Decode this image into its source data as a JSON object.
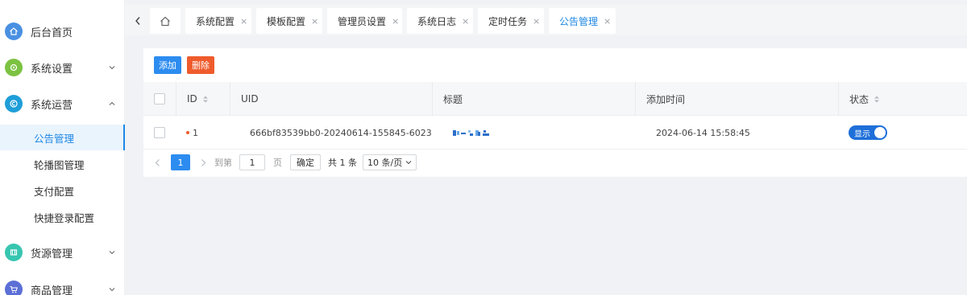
{
  "sidebar": {
    "menu": [
      {
        "label": "后台首页",
        "icon": "home-icon",
        "color": "#4a90e2",
        "glyph": "⌂",
        "expandable": false
      },
      {
        "label": "系统设置",
        "icon": "gear-icon",
        "color": "#7cc242",
        "glyph": "⚙",
        "expandable": true,
        "expanded": false
      },
      {
        "label": "系统运营",
        "icon": "operation-icon",
        "color": "#1e9ed8",
        "glyph": "©",
        "expandable": true,
        "expanded": true
      },
      {
        "label": "货源管理",
        "icon": "supply-icon",
        "color": "#37c6b0",
        "glyph": "仓",
        "expandable": true,
        "expanded": false
      },
      {
        "label": "商品管理",
        "icon": "cart-icon",
        "color": "#5b6fd6",
        "glyph": "⊞",
        "expandable": true,
        "expanded": false
      }
    ],
    "submenu": [
      {
        "label": "公告管理",
        "active": true
      },
      {
        "label": "轮播图管理",
        "active": false
      },
      {
        "label": "支付配置",
        "active": false
      },
      {
        "label": "快捷登录配置",
        "active": false
      }
    ]
  },
  "tabs": [
    {
      "label": "系统配置",
      "active": false
    },
    {
      "label": "模板配置",
      "active": false
    },
    {
      "label": "管理员设置",
      "active": false
    },
    {
      "label": "系统日志",
      "active": false
    },
    {
      "label": "定时任务",
      "active": false
    },
    {
      "label": "公告管理",
      "active": true
    }
  ],
  "toolbar": {
    "add_label": "添加",
    "delete_label": "删除"
  },
  "table": {
    "columns": {
      "id": "ID",
      "uid": "UID",
      "title": "标题",
      "add_time": "添加时间",
      "status": "状态"
    },
    "rows": [
      {
        "id": "1",
        "uid": "666bf83539bb0-20240614-155845-6023",
        "add_time": "2024-06-14 15:58:45",
        "status_label": "显示",
        "status_on": true
      }
    ]
  },
  "pager": {
    "current_page": "1",
    "goto_label": "到第",
    "goto_value": "1",
    "page_unit": "页",
    "confirm_label": "确定",
    "total_text": "共 1 条",
    "page_size": "10 条/页"
  },
  "colors": {
    "accent": "#1e88e5",
    "danger": "#ef5b2c",
    "primary": "#2d8cf0"
  }
}
